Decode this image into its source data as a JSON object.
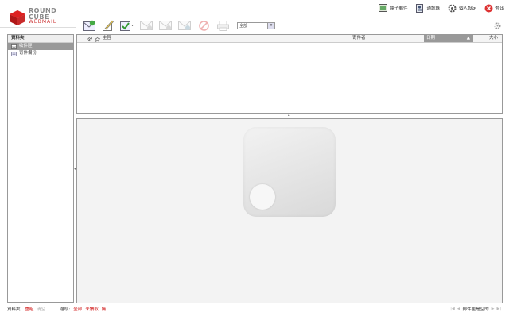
{
  "logo": {
    "line1": "ROUND",
    "line2": "CUBE",
    "line3": "WEBMAIL"
  },
  "topnav": [
    {
      "label": "電子郵件",
      "icon": "mail-icon"
    },
    {
      "label": "通訊錄",
      "icon": "addressbook-icon"
    },
    {
      "label": "個人設定",
      "icon": "gear-icon"
    },
    {
      "label": "登出",
      "icon": "logout-icon"
    }
  ],
  "toolbar": {
    "filter_value": "全部"
  },
  "folders": {
    "header": "資料夾",
    "items": [
      {
        "label": "收件匣",
        "selected": true
      },
      {
        "label": "寄件備份",
        "selected": false
      }
    ]
  },
  "msglist": {
    "col_subject": "主旨",
    "col_sender": "寄件者",
    "col_date": "日期",
    "col_size": "大小"
  },
  "footer": {
    "folder_label": "資料夾:",
    "compact": "重組",
    "empty": "清空",
    "select_label": "選取:",
    "select_all": "全部",
    "select_unread": "未讀取",
    "select_none": "無",
    "status": "郵件匣是空的"
  },
  "colors": {
    "accent": "#cc0000",
    "selected_bg": "#999999"
  }
}
